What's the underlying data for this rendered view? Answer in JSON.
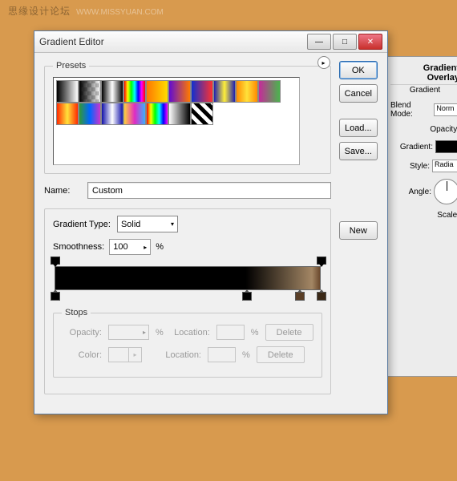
{
  "watermark": {
    "text1": "思缘设计论坛",
    "text2": "WWW.MISSYUAN.COM"
  },
  "bgPanel": {
    "title": "Gradient Overlay",
    "subtitle": "Gradient",
    "blendModeLabel": "Blend Mode:",
    "blendModeValue": "Norm",
    "opacityLabel": "Opacity:",
    "gradientLabel": "Gradient:",
    "styleLabel": "Style:",
    "styleValue": "Radia",
    "angleLabel": "Angle:",
    "scaleLabel": "Scale:"
  },
  "dialog": {
    "title": "Gradient Editor",
    "buttons": {
      "ok": "OK",
      "cancel": "Cancel",
      "load": "Load...",
      "save": "Save...",
      "new": "New"
    },
    "presetsLabel": "Presets",
    "presets": [
      "linear-gradient(to right,#000,#fff)",
      "linear-gradient(to right,#000,rgba(0,0,0,0)) , repeating-conic-gradient(#ccc 0 25%, #fff 0 50%) 0/10px 10px",
      "linear-gradient(to right,#000,#fff,#000)",
      "linear-gradient(to right,#f00,#ff0,#0f0,#0ff,#00f,#f0f,#f00)",
      "linear-gradient(to right,#f70,#fd0)",
      "linear-gradient(to right,#610bd1,#ff7a00)",
      "linear-gradient(to right,#1030d0,#ff3030)",
      "linear-gradient(to right,#2020b0,#ffef3a,#2020b0)",
      "linear-gradient(to right,#ff8a00,#ffe13a,#ff8a00)",
      "linear-gradient(to right,#c62a9a,#49b54c)",
      "linear-gradient(to right,#ff2a00,#ffe23a,#ff2a00)",
      "linear-gradient(to right,#393,#06f,#c3c)",
      "linear-gradient(to right,#11a,#fff,#11a)",
      "linear-gradient(to right,#ffd23a,#e02ac3,#3ab0ff)",
      "linear-gradient(to right,#f00,#ff0,#0f0,#0ff,#00f,#f0f)",
      "linear-gradient(to right,#fff,#000)",
      "repeating-linear-gradient(45deg,#000 0 5px,#fff 5px 10px)"
    ],
    "nameLabel": "Name:",
    "nameValue": "Custom",
    "gradientTypeLabel": "Gradient Type:",
    "gradientTypeValue": "Solid",
    "smoothnessLabel": "Smoothness:",
    "smoothnessValue": "100",
    "percent": "%",
    "stops": {
      "legend": "Stops",
      "opacityLabel": "Opacity:",
      "locationLabel": "Location:",
      "colorLabel": "Color:",
      "delete": "Delete"
    },
    "colorStops": [
      {
        "pos": 0,
        "color": "#000000"
      },
      {
        "pos": 72,
        "color": "#000000"
      },
      {
        "pos": 92,
        "color": "#5a3e26"
      },
      {
        "pos": 100,
        "color": "#3a2816"
      }
    ],
    "opacityStops": [
      {
        "pos": 0
      },
      {
        "pos": 100
      }
    ]
  }
}
